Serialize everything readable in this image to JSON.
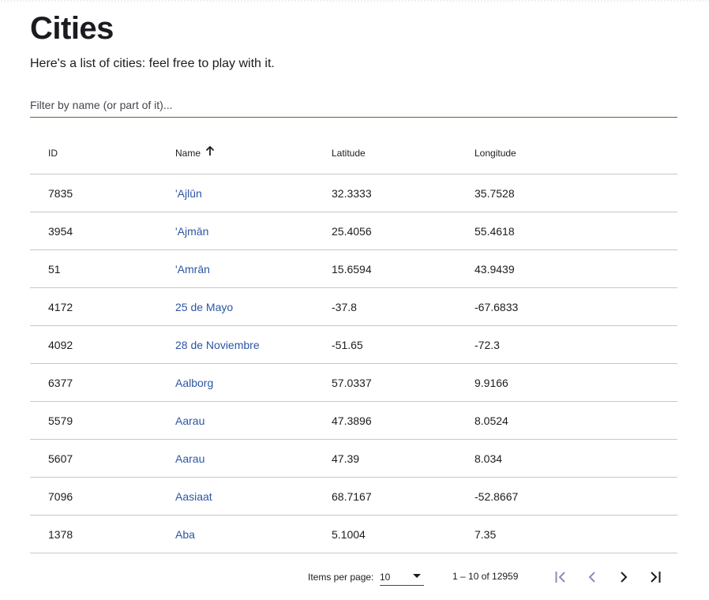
{
  "header": {
    "title": "Cities",
    "subtitle": "Here's a list of cities: feel free to play with it."
  },
  "filter": {
    "placeholder": "Filter by name (or part of it)...",
    "value": ""
  },
  "table": {
    "columns": {
      "id": "ID",
      "name": "Name",
      "latitude": "Latitude",
      "longitude": "Longitude"
    },
    "sort": {
      "column": "name",
      "direction": "ascending",
      "icon": "arrow-up-icon"
    },
    "rows": [
      {
        "id": "7835",
        "name": "'Ajlūn",
        "lat": "32.3333",
        "lon": "35.7528"
      },
      {
        "id": "3954",
        "name": "'Ajmān",
        "lat": "25.4056",
        "lon": "55.4618"
      },
      {
        "id": "51",
        "name": "'Amrān",
        "lat": "15.6594",
        "lon": "43.9439"
      },
      {
        "id": "4172",
        "name": "25 de Mayo",
        "lat": "-37.8",
        "lon": "-67.6833"
      },
      {
        "id": "4092",
        "name": "28 de Noviembre",
        "lat": "-51.65",
        "lon": "-72.3"
      },
      {
        "id": "6377",
        "name": "Aalborg",
        "lat": "57.0337",
        "lon": "9.9166"
      },
      {
        "id": "5579",
        "name": "Aarau",
        "lat": "47.3896",
        "lon": "8.0524"
      },
      {
        "id": "5607",
        "name": "Aarau",
        "lat": "47.39",
        "lon": "8.034"
      },
      {
        "id": "7096",
        "name": "Aasiaat",
        "lat": "68.7167",
        "lon": "-52.8667"
      },
      {
        "id": "1378",
        "name": "Aba",
        "lat": "5.1004",
        "lon": "7.35"
      }
    ]
  },
  "paginator": {
    "items_per_page_label": "Items per page:",
    "items_per_page": "10",
    "range_label": "1 – 10 of 12959",
    "icons": {
      "first": "first-page-icon",
      "prev": "chevron-left-icon",
      "next": "chevron-right-icon",
      "last": "last-page-icon"
    }
  },
  "colors": {
    "text": "#1d1b20",
    "link": "#2d55a5",
    "divider": "#c9c5cf",
    "disabled_icon": "#9a84b8",
    "filter_underline": "#6b6330"
  }
}
